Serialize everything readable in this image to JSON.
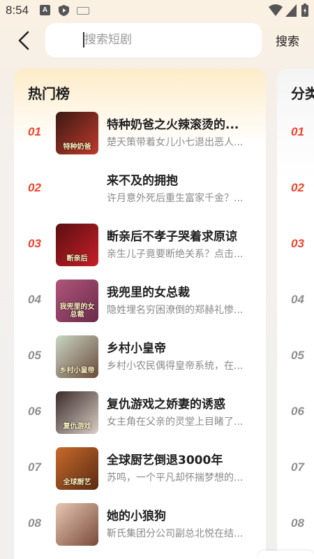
{
  "status_bar": {
    "time": "8:54",
    "icons": [
      "app-a-icon",
      "shield-icon",
      "keyboard-icon",
      "wifi-icon",
      "signal-icon",
      "battery-icon"
    ]
  },
  "header": {
    "back_icon": "back-arrow-icon",
    "search_placeholder": "搜索短剧",
    "search_button": "搜索"
  },
  "hot_list": {
    "title": "热门榜",
    "items": [
      {
        "rank": "01",
        "title": "特种奶爸之火辣滚烫的...",
        "desc": "楚天策带着女儿小七退出恶人...",
        "thumb_text": "特种奶爸",
        "thumb_colors": [
          "#3a1a14",
          "#c0392b"
        ],
        "has_thumb": true
      },
      {
        "rank": "02",
        "title": "来不及的拥抱",
        "desc": "许月意外死后重生富家千金？...",
        "thumb_text": "",
        "thumb_colors": [
          "#ffffff",
          "#ffffff"
        ],
        "has_thumb": false
      },
      {
        "rank": "03",
        "title": "断亲后不孝子哭着求原谅",
        "desc": "亲生儿子竟要断绝关系？点击...",
        "thumb_text": "断亲后",
        "thumb_colors": [
          "#5a0f12",
          "#c81f28"
        ],
        "has_thumb": true
      },
      {
        "rank": "04",
        "title": "我兜里的女总裁",
        "desc": "隐姓埋名穷困潦倒的郑赫礼惨...",
        "thumb_text": "我兜里的女总裁",
        "thumb_colors": [
          "#b0567a",
          "#6a2a4a"
        ],
        "has_thumb": true
      },
      {
        "rank": "05",
        "title": "乡村小皇帝",
        "desc": "乡村小农民偶得皇帝系统，在...",
        "thumb_text": "乡村小皇帝",
        "thumb_colors": [
          "#c9d6c4",
          "#6b4a3a"
        ],
        "has_thumb": true
      },
      {
        "rank": "06",
        "title": "复仇游戏之娇妻的诱惑",
        "desc": "女主角在父亲的灵堂上目睹了...",
        "thumb_text": "复仇游戏",
        "thumb_colors": [
          "#3a2a2a",
          "#d9cfc4"
        ],
        "has_thumb": true
      },
      {
        "rank": "07",
        "title": "全球厨艺倒退3000年",
        "desc": "苏鸣，一个平凡却怀揣梦想的...",
        "thumb_text": "全球厨艺",
        "thumb_colors": [
          "#c86a2a",
          "#5a2a14"
        ],
        "has_thumb": true
      },
      {
        "rank": "08",
        "title": "她的小狼狗",
        "desc": "靳氏集团分公司副总北悦在结...",
        "thumb_text": "",
        "thumb_colors": [
          "#e6c7b4",
          "#7a4a3a"
        ],
        "has_thumb": true
      }
    ]
  },
  "category_list": {
    "title": "分类",
    "ranks": [
      "01",
      "02",
      "03",
      "04",
      "05",
      "06",
      "07",
      "08"
    ]
  },
  "colors": {
    "top_rank": "#f0442c",
    "normal_rank": "#8e8e8e",
    "card_header": "#fdecc8"
  }
}
